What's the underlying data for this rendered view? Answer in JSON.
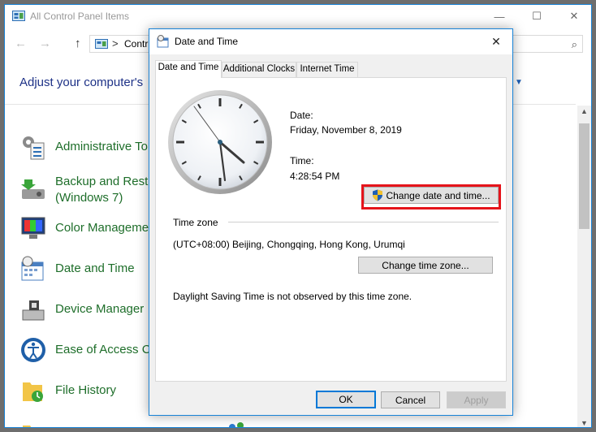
{
  "control_panel": {
    "title": "All Control Panel Items",
    "breadcrumb": "Contr",
    "breadcrumb_separator": ">",
    "heading": "Adjust your computer's",
    "items": [
      {
        "label": "Administrative To",
        "icon": "administrative-tools-icon"
      },
      {
        "label": "Backup and Rest\n(Windows 7)",
        "icon": "backup-restore-icon"
      },
      {
        "label": "Color Manageme",
        "icon": "color-management-icon"
      },
      {
        "label": "Date and Time",
        "icon": "date-time-icon"
      },
      {
        "label": "Device Manager",
        "icon": "device-manager-icon"
      },
      {
        "label": "Ease of Access Ce",
        "icon": "ease-of-access-icon"
      },
      {
        "label": "File History",
        "icon": "file-history-icon"
      }
    ],
    "caption_buttons": {
      "minimize": "—",
      "maximize": "☐",
      "close": "✕"
    }
  },
  "dialog": {
    "title": "Date and Time",
    "close": "✕",
    "tabs": [
      {
        "label": "Date and Time",
        "active": true
      },
      {
        "label": "Additional Clocks",
        "active": false
      },
      {
        "label": "Internet Time",
        "active": false
      }
    ],
    "date_label": "Date:",
    "date_value": "Friday, November 8, 2019",
    "time_label": "Time:",
    "time_value": "4:28:54 PM",
    "change_datetime_button": "Change date and time...",
    "timezone_section": "Time zone",
    "timezone_value": "(UTC+08:00) Beijing, Chongqing, Hong Kong, Urumqi",
    "change_timezone_button": "Change time zone...",
    "dst_note": "Daylight Saving Time is not observed by this time zone.",
    "ok_button": "OK",
    "cancel_button": "Cancel",
    "apply_button": "Apply"
  },
  "colors": {
    "accent": "#1883d7",
    "highlight": "#e5141b",
    "link_green": "#1e6e2a",
    "heading_blue": "#1e3287"
  }
}
